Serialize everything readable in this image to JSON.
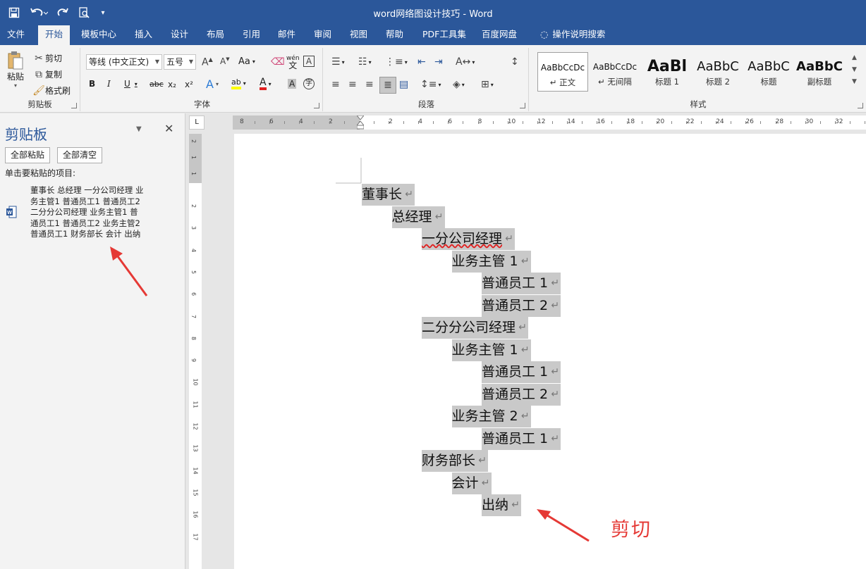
{
  "title_bar": {
    "doc_title": "word网络图设计技巧 - Word",
    "quick_access": [
      "save-icon",
      "undo-icon",
      "redo-icon",
      "print-preview-icon",
      "customize-icon"
    ]
  },
  "tabs": [
    {
      "label": "文件"
    },
    {
      "label": "开始"
    },
    {
      "label": "模板中心"
    },
    {
      "label": "插入"
    },
    {
      "label": "设计"
    },
    {
      "label": "布局"
    },
    {
      "label": "引用"
    },
    {
      "label": "邮件"
    },
    {
      "label": "审阅"
    },
    {
      "label": "视图"
    },
    {
      "label": "帮助"
    },
    {
      "label": "PDF工具集"
    },
    {
      "label": "百度网盘"
    },
    {
      "label": "操作说明搜索"
    }
  ],
  "ribbon": {
    "clipboard": {
      "label": "剪贴板",
      "paste": "粘贴",
      "cut": "剪切",
      "copy": "复制",
      "format_painter": "格式刷"
    },
    "font": {
      "label": "字体",
      "font_name": "等线 (中文正文)",
      "font_size": "五号",
      "case_label": "Aa",
      "phonetic_label": "wén",
      "bold": "B",
      "italic": "I",
      "underline": "U",
      "strike": "abc",
      "subscript": "x₂",
      "superscript": "x²",
      "effects": "A",
      "highlight": "ab",
      "font_color": "A",
      "shading": "A",
      "enclose": "字"
    },
    "paragraph": {
      "label": "段落"
    },
    "styles": {
      "label": "样式",
      "items": [
        {
          "sample": "AaBbCcDc",
          "name": "正文"
        },
        {
          "sample": "AaBbCcDc",
          "name": "无间隔"
        },
        {
          "sample": "AaBl",
          "name": "标题 1"
        },
        {
          "sample": "AaBbC",
          "name": "标题 2"
        },
        {
          "sample": "AaBbC",
          "name": "标题"
        },
        {
          "sample": "AaBbC",
          "name": "副标题"
        }
      ]
    }
  },
  "clipboard_pane": {
    "title": "剪贴板",
    "paste_all": "全部粘贴",
    "clear_all": "全部清空",
    "hint": "单击要粘贴的项目:",
    "item_lines": [
      "董事长 总经理 一分公司经理 业",
      "务主管1 普通员工1 普通员工2",
      "二分分公司经理 业务主管1 普",
      "通员工1 普通员工2 业务主管2",
      "普通员工1 财务部长 会计 出纳"
    ]
  },
  "ruler": {
    "corner": "L",
    "h_ticks": [
      "8",
      "6",
      "4",
      "2",
      "2",
      "4",
      "6",
      "8",
      "10",
      "12",
      "14",
      "16",
      "18",
      "20",
      "22",
      "24",
      "26",
      "28",
      "30",
      "32"
    ],
    "v_ticks": [
      "2",
      "1",
      "1",
      "2",
      "3",
      "4",
      "5",
      "6",
      "7",
      "8",
      "9",
      "10",
      "11",
      "12",
      "13",
      "14",
      "15",
      "16",
      "17"
    ]
  },
  "document": {
    "lines": [
      {
        "text": "董事长",
        "level": 0
      },
      {
        "text": "总经理",
        "level": 1
      },
      {
        "text": "一分公司经理",
        "level": 2
      },
      {
        "text": "业务主管 1",
        "level": 3
      },
      {
        "text": "普通员工 1",
        "level": 4
      },
      {
        "text": "普通员工 2",
        "level": 4
      },
      {
        "text": "二分分公司经理",
        "level": 2
      },
      {
        "text": "业务主管 1",
        "level": 3
      },
      {
        "text": "普通员工 1",
        "level": 4
      },
      {
        "text": "普通员工 2",
        "level": 4
      },
      {
        "text": "业务主管 2",
        "level": 3
      },
      {
        "text": "普通员工 1",
        "level": 4
      },
      {
        "text": "财务部长",
        "level": 2
      },
      {
        "text": "会计",
        "level": 3
      },
      {
        "text": "出纳",
        "level": 4
      }
    ],
    "para_mark": "↵"
  },
  "annotation": {
    "label": "剪切",
    "color": "#e53935"
  },
  "colors": {
    "accent": "#2b579a",
    "highlight": "#c9c9c9",
    "annotation": "#e53935"
  }
}
